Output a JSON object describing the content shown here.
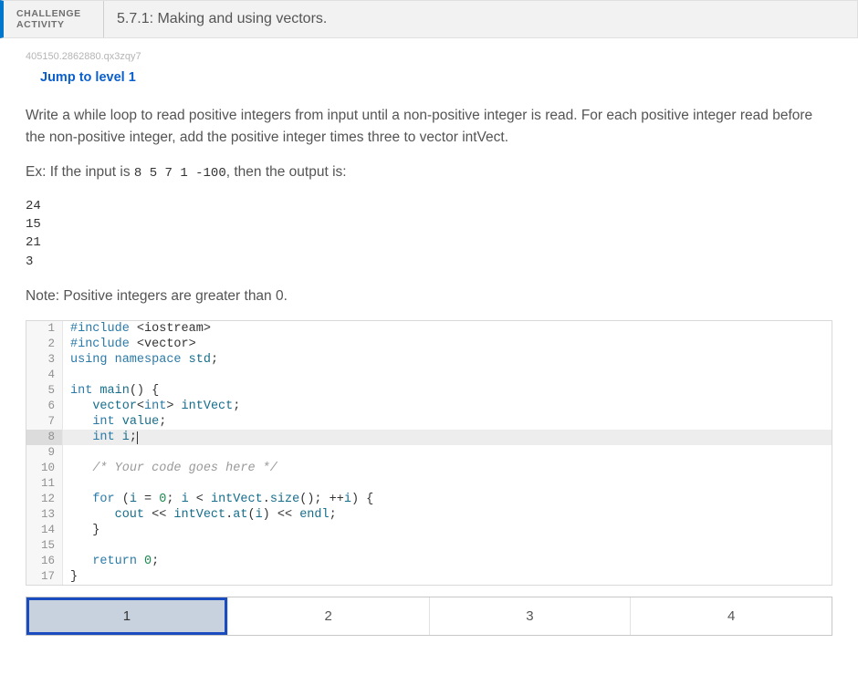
{
  "header": {
    "badge_line1": "CHALLENGE",
    "badge_line2": "ACTIVITY",
    "title": "5.7.1: Making and using vectors."
  },
  "hash": "405150.2862880.qx3zqy7",
  "jump_link": "Jump to level 1",
  "prompt": {
    "para1": "Write a while loop to read positive integers from input until a non-positive integer is read. For each positive integer read before the non-positive integer, add the positive integer times three to vector intVect.",
    "ex_prefix": "Ex: If the input is ",
    "ex_input": "8 5 7 1 -100",
    "ex_suffix": ", then the output is:",
    "output": "24\n15\n21\n3",
    "note": "Note: Positive integers are greater than 0."
  },
  "code": {
    "active_line": 8,
    "lines": [
      {
        "n": 1,
        "tokens": [
          [
            "kw",
            "#include "
          ],
          [
            "op",
            "<iostream>"
          ]
        ]
      },
      {
        "n": 2,
        "tokens": [
          [
            "kw",
            "#include "
          ],
          [
            "op",
            "<vector>"
          ]
        ]
      },
      {
        "n": 3,
        "tokens": [
          [
            "kw",
            "using "
          ],
          [
            "kw2",
            "namespace "
          ],
          [
            "id",
            "std"
          ],
          [
            "op",
            ";"
          ]
        ]
      },
      {
        "n": 4,
        "tokens": []
      },
      {
        "n": 5,
        "tokens": [
          [
            "kw",
            "int "
          ],
          [
            "id",
            "main"
          ],
          [
            "op",
            "() {"
          ]
        ]
      },
      {
        "n": 6,
        "tokens": [
          [
            "op",
            "   "
          ],
          [
            "id",
            "vector"
          ],
          [
            "op",
            "<"
          ],
          [
            "kw",
            "int"
          ],
          [
            "op",
            "> "
          ],
          [
            "id",
            "intVect"
          ],
          [
            "op",
            ";"
          ]
        ]
      },
      {
        "n": 7,
        "tokens": [
          [
            "op",
            "   "
          ],
          [
            "kw",
            "int "
          ],
          [
            "id",
            "value"
          ],
          [
            "op",
            ";"
          ]
        ]
      },
      {
        "n": 8,
        "tokens": [
          [
            "op",
            "   "
          ],
          [
            "kw",
            "int "
          ],
          [
            "id",
            "i"
          ],
          [
            "op",
            ";"
          ]
        ],
        "cursor": true
      },
      {
        "n": 9,
        "tokens": []
      },
      {
        "n": 10,
        "tokens": [
          [
            "op",
            "   "
          ],
          [
            "cm",
            "/* Your code goes here */"
          ]
        ]
      },
      {
        "n": 11,
        "tokens": []
      },
      {
        "n": 12,
        "tokens": [
          [
            "op",
            "   "
          ],
          [
            "kw",
            "for "
          ],
          [
            "op",
            "("
          ],
          [
            "id",
            "i"
          ],
          [
            "op",
            " = "
          ],
          [
            "num",
            "0"
          ],
          [
            "op",
            "; "
          ],
          [
            "id",
            "i"
          ],
          [
            "op",
            " < "
          ],
          [
            "id",
            "intVect"
          ],
          [
            "op",
            "."
          ],
          [
            "id",
            "size"
          ],
          [
            "op",
            "(); ++"
          ],
          [
            "id",
            "i"
          ],
          [
            "op",
            ") {"
          ]
        ]
      },
      {
        "n": 13,
        "tokens": [
          [
            "op",
            "      "
          ],
          [
            "id",
            "cout"
          ],
          [
            "op",
            " << "
          ],
          [
            "id",
            "intVect"
          ],
          [
            "op",
            "."
          ],
          [
            "id",
            "at"
          ],
          [
            "op",
            "("
          ],
          [
            "id",
            "i"
          ],
          [
            "op",
            ") << "
          ],
          [
            "id",
            "endl"
          ],
          [
            "op",
            ";"
          ]
        ]
      },
      {
        "n": 14,
        "tokens": [
          [
            "op",
            "   }"
          ]
        ]
      },
      {
        "n": 15,
        "tokens": []
      },
      {
        "n": 16,
        "tokens": [
          [
            "op",
            "   "
          ],
          [
            "kw",
            "return "
          ],
          [
            "num",
            "0"
          ],
          [
            "op",
            ";"
          ]
        ]
      },
      {
        "n": 17,
        "tokens": [
          [
            "op",
            "}"
          ]
        ]
      }
    ]
  },
  "levels": {
    "active": 1,
    "items": [
      "1",
      "2",
      "3",
      "4"
    ]
  }
}
